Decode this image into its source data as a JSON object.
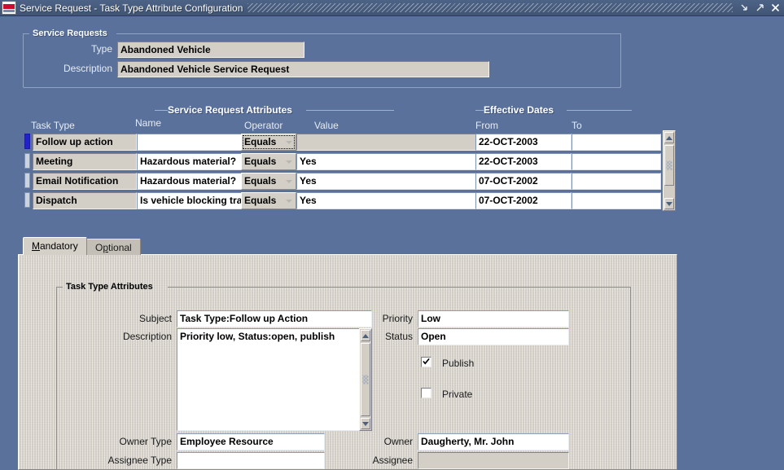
{
  "window": {
    "title": "Service Request - Task Type Attribute Configuration",
    "logo_name": "oracle-logo",
    "buttons": {
      "minimize": "minimize",
      "maximize": "maximize",
      "close": "close"
    }
  },
  "service_requests": {
    "legend": "Service Requests",
    "type_label": "Type",
    "type_value": "Abandoned Vehicle",
    "description_label": "Description",
    "description_value": "Abandoned Vehicle Service Request"
  },
  "attributes_block": {
    "legend": "Service Request Attributes",
    "dates_legend": "Effective Dates",
    "columns": {
      "task_type": "Task Type",
      "name": "Name",
      "operator": "Operator",
      "value": "Value",
      "from": "From",
      "to": "To"
    },
    "rows": [
      {
        "task_type": "Follow up action",
        "name": "",
        "operator": "Equals",
        "value": "",
        "from": "22-OCT-2003",
        "to": "",
        "selected": true
      },
      {
        "task_type": "Meeting",
        "name": "Hazardous material?",
        "operator": "Equals",
        "value": "Yes",
        "from": "22-OCT-2003",
        "to": "",
        "selected": false
      },
      {
        "task_type": "Email Notification",
        "name": "Hazardous material?",
        "operator": "Equals",
        "value": "Yes",
        "from": "07-OCT-2002",
        "to": "",
        "selected": false
      },
      {
        "task_type": "Dispatch",
        "name": "Is vehicle blocking tra",
        "operator": "Equals",
        "value": "Yes",
        "from": "07-OCT-2002",
        "to": "",
        "selected": false
      }
    ]
  },
  "tabs": [
    {
      "label": "Mandatory",
      "mnemonic": "M",
      "active": true
    },
    {
      "label": "Optional",
      "mnemonic": "p",
      "active": false
    }
  ],
  "task_type_attributes": {
    "legend": "Task Type Attributes",
    "subject_label": "Subject",
    "subject_value": "Task Type:Follow up Action",
    "description_label": "Description",
    "description_value": "Priority low, Status:open, publish",
    "owner_type_label": "Owner Type",
    "owner_type_value": "Employee Resource",
    "assignee_type_label": "Assignee Type",
    "assignee_type_value": "",
    "priority_label": "Priority",
    "priority_value": "Low",
    "status_label": "Status",
    "status_value": "Open",
    "publish_label": "Publish",
    "publish_checked": true,
    "private_label": "Private",
    "private_checked": false,
    "owner_label": "Owner",
    "owner_value": "Daugherty, Mr. John",
    "assignee_label": "Assignee",
    "assignee_value": ""
  },
  "colors": {
    "window_background": "#5a719b",
    "titlebar": "#4d6387",
    "panel_gray": "#d4d0c8",
    "field_readonly": "#d3cfc7",
    "record_indicator": "#2222cc"
  }
}
